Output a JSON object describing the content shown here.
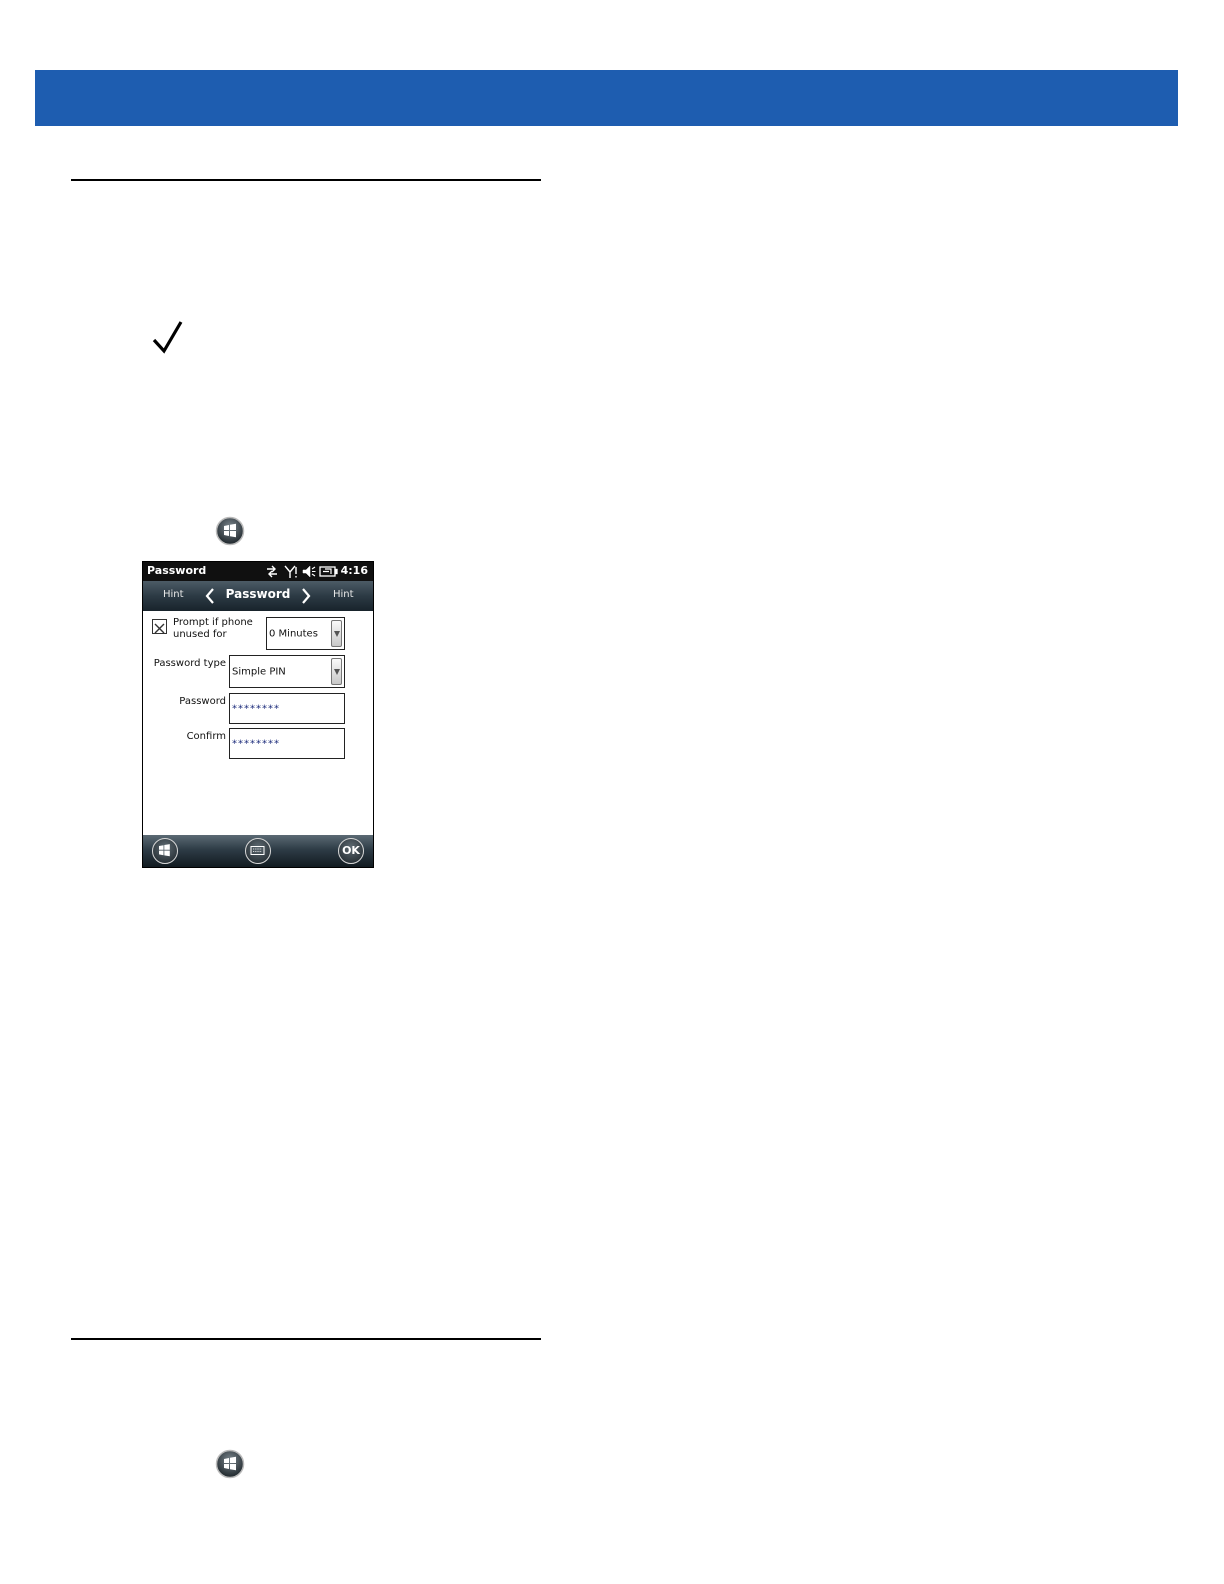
{
  "phone": {
    "status_bar": {
      "title": "Password",
      "time": "4:16",
      "icons": [
        "sync-icon",
        "signal-icon",
        "speaker-muted-icon",
        "battery-charging-icon"
      ]
    },
    "nav_bar": {
      "left_hint": "Hint",
      "title": "Password",
      "right_hint": "Hint"
    },
    "form": {
      "prompt_line1": "Prompt if phone",
      "prompt_line2": "unused for",
      "prompt_checked": true,
      "prompt_value": "0 Minutes",
      "password_type_label": "Password type",
      "password_type_value": "Simple PIN",
      "password_label": "Password",
      "password_value": "********",
      "confirm_label": "Confirm",
      "confirm_value": "********"
    },
    "soft_keys": {
      "ok_label": "OK"
    }
  },
  "colors": {
    "header_band": "#1e5db0",
    "status_bar": "#101010",
    "masked_text": "#1a2a7a"
  }
}
